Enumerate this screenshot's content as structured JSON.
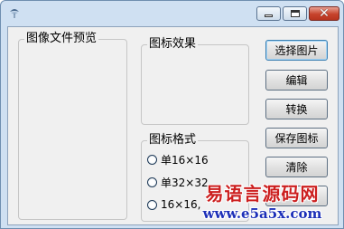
{
  "colors": {
    "frame": "#cfe0f2",
    "client": "#f0f0f0",
    "close_button": "#c7432c",
    "watermark_title": "#cc1f1f",
    "watermark_url": "#1c2fb8"
  },
  "titlebar": {
    "app_icon": "app-icon",
    "controls": {
      "minimize": "minimize-icon",
      "maximize": "maximize-icon",
      "close": "close-icon"
    },
    "close_glyph": "✕"
  },
  "groups": {
    "preview": {
      "label": "图像文件预览"
    },
    "effect": {
      "label": "图标效果"
    },
    "format": {
      "label": "图标格式",
      "options": [
        {
          "label": "单16×16",
          "selected": false
        },
        {
          "label": "单32×32",
          "selected": false
        },
        {
          "label": "16×16,",
          "selected": false
        }
      ]
    }
  },
  "buttons": {
    "select_image": "选择图片",
    "edit": "编辑",
    "convert": "转换",
    "save_icon": "保存图标",
    "clear": "清除",
    "exit": ""
  },
  "watermark": {
    "title": "易语言源码网",
    "url": "www.e5a5x.com"
  }
}
